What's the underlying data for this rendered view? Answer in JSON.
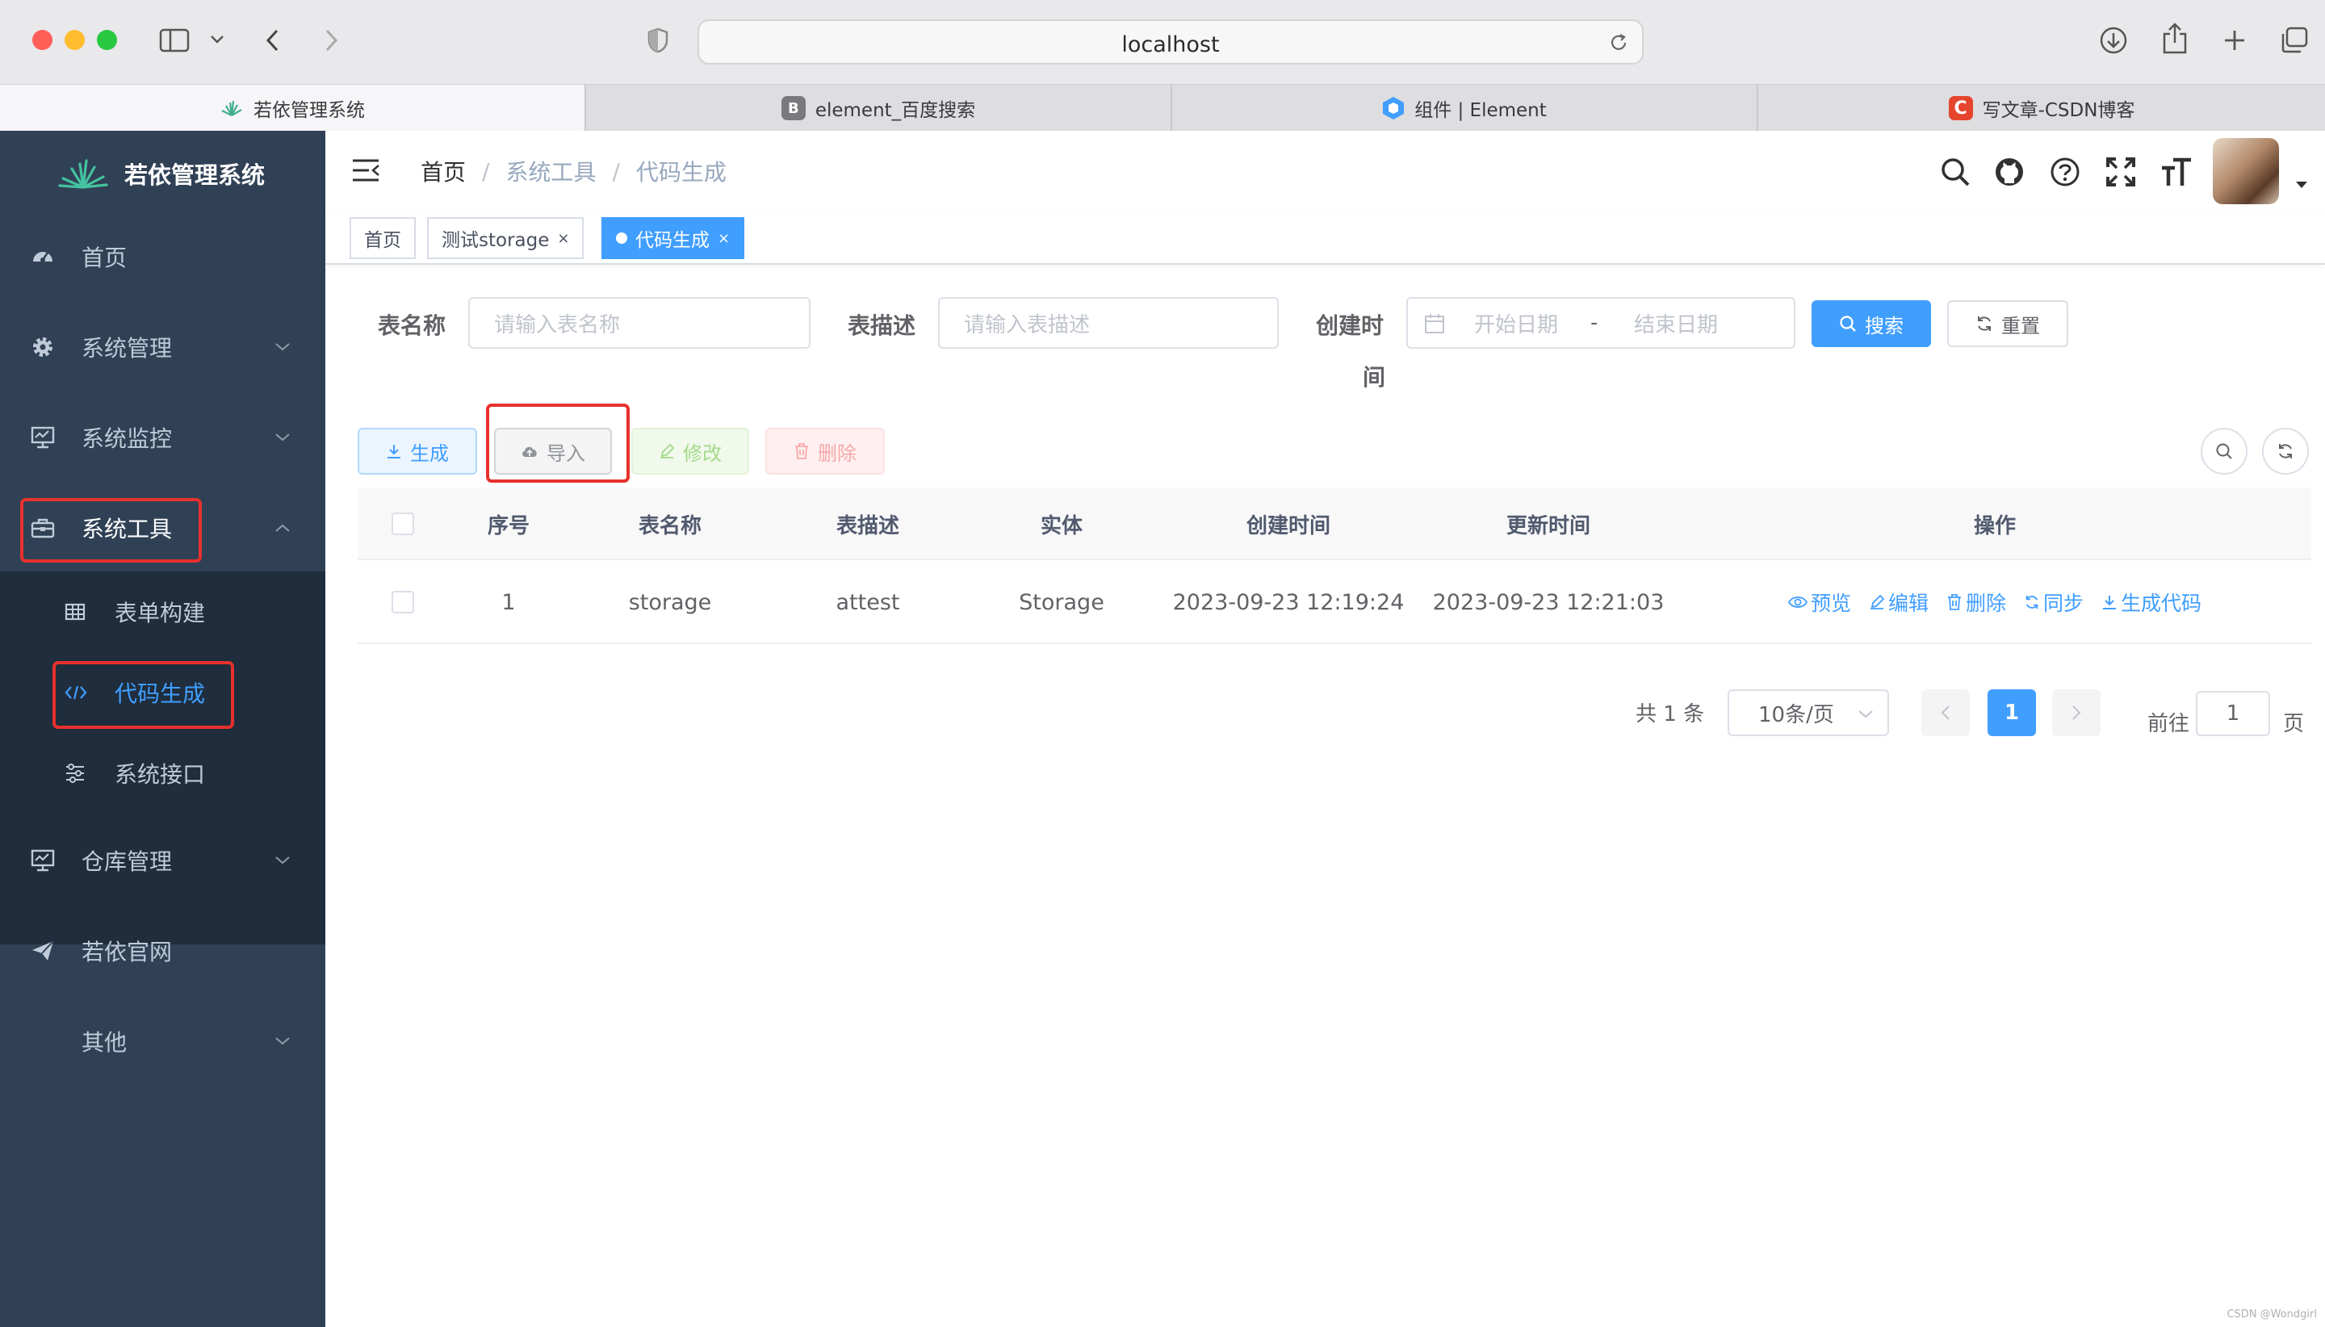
{
  "browser": {
    "url": "localhost",
    "tabs": [
      {
        "label": "若依管理系统",
        "active": true
      },
      {
        "label": "element_百度搜索",
        "favicon": "B"
      },
      {
        "label": "组件 | Element"
      },
      {
        "label": "写文章-CSDN博客",
        "favicon": "C"
      }
    ]
  },
  "sidebar": {
    "title": "若依管理系统",
    "items": [
      {
        "label": "首页",
        "icon": "dashboard-icon"
      },
      {
        "label": "系统管理",
        "icon": "gear-icon"
      },
      {
        "label": "系统监控",
        "icon": "monitor-icon"
      },
      {
        "label": "系统工具",
        "icon": "toolbox-icon",
        "expanded": true
      },
      {
        "label": "表单构建",
        "icon": "table-icon"
      },
      {
        "label": "代码生成",
        "icon": "code-icon",
        "active": true
      },
      {
        "label": "系统接口",
        "icon": "sliders-icon"
      },
      {
        "label": "仓库管理",
        "icon": "monitor-icon"
      },
      {
        "label": "若依官网",
        "icon": "send-icon"
      },
      {
        "label": "其他",
        "icon": ""
      }
    ]
  },
  "navbar": {
    "breadcrumb": [
      "首页",
      "系统工具",
      "代码生成"
    ],
    "breadcrumb_sep": "/"
  },
  "tags": [
    {
      "label": "首页"
    },
    {
      "label": "测试storage",
      "close": "×"
    },
    {
      "label": "代码生成",
      "close": "×",
      "active": true
    }
  ],
  "search": {
    "table_name_label": "表名称",
    "table_name_placeholder": "请输入表名称",
    "table_desc_label": "表描述",
    "table_desc_placeholder": "请输入表描述",
    "create_time_label_1": "创建时",
    "create_time_label_2": "间",
    "start_placeholder": "开始日期",
    "range_sep": "-",
    "end_placeholder": "结束日期",
    "search_btn": "搜索",
    "reset_btn": "重置"
  },
  "toolbar": {
    "generate": "生成",
    "import": "导入",
    "edit": "修改",
    "delete": "删除"
  },
  "table": {
    "columns": [
      "序号",
      "表名称",
      "表描述",
      "实体",
      "创建时间",
      "更新时间",
      "操作"
    ],
    "rows": [
      {
        "index": "1",
        "table_name": "storage",
        "table_desc": "attest",
        "entity": "Storage",
        "created": "2023-09-23 12:19:24",
        "updated": "2023-09-23 12:21:03",
        "ops": [
          "预览",
          "编辑",
          "删除",
          "同步",
          "生成代码"
        ]
      }
    ]
  },
  "pagination": {
    "total": "共 1 条",
    "page_size": "10条/页",
    "current": "1",
    "goto_label": "前往",
    "goto_value": "1",
    "page_suffix": "页"
  },
  "watermark": "CSDN @Wondgirl",
  "colors": {
    "sidebar_bg": "#304156",
    "submenu_bg": "#1f2d3d",
    "primary": "#409eff",
    "highlight_box": "#e8312d"
  }
}
